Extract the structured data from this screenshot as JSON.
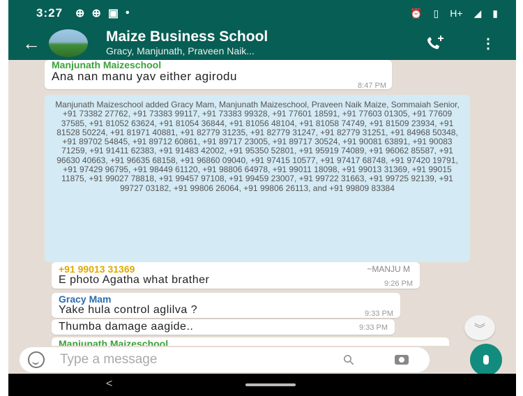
{
  "status_bar": {
    "time": "3:27",
    "network": "H+"
  },
  "header": {
    "title": "Maize Business School",
    "subtitle": "Gracy, Manjunath, Praveen Naik..."
  },
  "messages": [
    {
      "sender": "Manjunath Maizeschool",
      "sender_color": "#3aa23a",
      "text": "Ana nan manu yav either agirodu",
      "time": "8:47 PM"
    },
    {
      "system": "Manjunath Maizeschool added Gracy Mam, Manjunath Maizeschool, Praveen Naik Maize, Sommaiah Senior, +91 73382 27762, +91 73383 99117, +91 73383 99328, +91 77601 18591, +91 77603 01305, +91 77609 37585, +91 81052 63624, +91 81054 36844, +91 81056 48104, +91 81058 74749, +91 81509 23934, +91 81528 50224, +91 81971 40881, +91 82779 31235, +91 82779 31247, +91 82779 31251, +91 84968 50348, +91 89702 54845, +91 89712 60861, +91 89717 23005, +91 89717 30524, +91 90081 63891, +91 90083 71259, +91 91411 62383, +91 91483 42002, +91 95350 52801, +91 95919 74089, +91 96062 85587, +91 96630 40663, +91 96635 68158, +91 96860 09040, +91 97415 10577, +91 97417 68748, +91 97420 19791, +91 97429 96795, +91 98449 61120, +91 98806 64978, +91 99011 18098, +91 99013 31369, +91 99015 11875, +91 99027 78818, +91 99457 97108, +91 99459 23007, +91 99722 31663, +91 99725 92139, +91 99727 03182, +91 99806 26064, +91 99806 26113, and +91 99809 83384"
    },
    {
      "sender": "+91 99013 31369",
      "sender_color": "#e0a800",
      "display_name": "~MANJU M",
      "text": "E photo Agatha what brather",
      "time": "9:26 PM"
    },
    {
      "sender": "Gracy Mam",
      "sender_color": "#2b6cb0",
      "text": "Yake hula control aglilva ?",
      "time": "9:33 PM"
    },
    {
      "text": "Thumba damage aagide..",
      "time": "9:33 PM"
    },
    {
      "sender": "Manjunath Maizeschool",
      "sender_color": "#3aa23a"
    }
  ],
  "composer": {
    "placeholder": "Type a message"
  },
  "colors": {
    "header": "#075e54",
    "chat_bg": "#e5ddd5",
    "system_bubble": "#d4eaf4",
    "fab": "#128c7e"
  },
  "icons": [
    "back-arrow-icon",
    "group-avatar-icon",
    "add-call-icon",
    "more-vert-icon",
    "emoji-icon",
    "attach-icon",
    "camera-icon",
    "mic-icon",
    "scroll-down-icon",
    "nav-back-icon",
    "nav-home-icon"
  ]
}
